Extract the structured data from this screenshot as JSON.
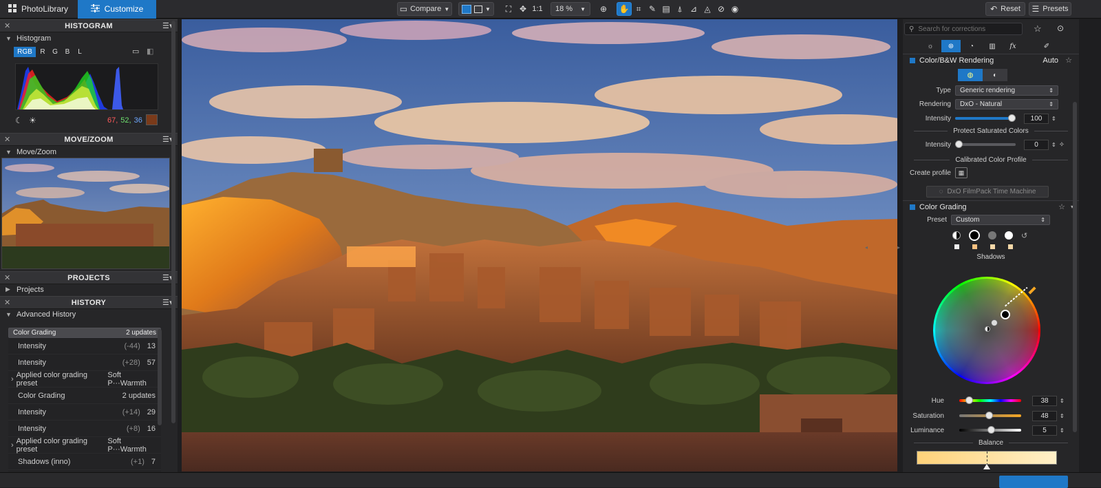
{
  "topbar": {
    "photolibrary_label": "PhotoLibrary",
    "customize_label": "Customize",
    "compare_label": "Compare",
    "ratio_label": "1:1",
    "zoom_value": "18 %",
    "reset_label": "Reset",
    "presets_label": "Presets"
  },
  "histogram": {
    "panel_title": "HISTOGRAM",
    "section_label": "Histogram",
    "channels": [
      "RGB",
      "R",
      "G",
      "B",
      "L"
    ],
    "active_channel": "RGB",
    "rgb_r": "67,",
    "rgb_g": "52,",
    "rgb_b": "36",
    "swatch_color": "#7a3a1a"
  },
  "movezoom": {
    "panel_title": "MOVE/ZOOM",
    "section_label": "Move/Zoom"
  },
  "projects": {
    "panel_title": "PROJECTS",
    "section_label": "Projects"
  },
  "history": {
    "panel_title": "HISTORY",
    "section_label": "Advanced History",
    "rows": [
      {
        "name": "Color Grading",
        "delta": "",
        "value": "2 updates",
        "expandable": false,
        "selected": true
      },
      {
        "name": "Intensity",
        "delta": "(-44)",
        "value": "13",
        "expandable": false,
        "selected": false
      },
      {
        "name": "Intensity",
        "delta": "(+28)",
        "value": "57",
        "expandable": false,
        "selected": false
      },
      {
        "name": "Applied color grading preset",
        "delta": "",
        "value": "Soft P···Warmth",
        "expandable": true,
        "selected": false
      },
      {
        "name": "Color Grading",
        "delta": "",
        "value": "2 updates",
        "expandable": false,
        "selected": false
      },
      {
        "name": "Intensity",
        "delta": "(+14)",
        "value": "29",
        "expandable": false,
        "selected": false
      },
      {
        "name": "Intensity",
        "delta": "(+8)",
        "value": "16",
        "expandable": false,
        "selected": false
      },
      {
        "name": "Applied color grading preset",
        "delta": "",
        "value": "Soft P···Warmth",
        "expandable": true,
        "selected": false
      },
      {
        "name": "Shadows (inno)",
        "delta": "(+1)",
        "value": "7",
        "expandable": false,
        "selected": false
      }
    ]
  },
  "right": {
    "search_placeholder": "Search for corrections",
    "color_bw": {
      "title": "Color/B&W Rendering",
      "auto_label": "Auto",
      "type_label": "Type",
      "type_value": "Generic rendering",
      "rendering_label": "Rendering",
      "rendering_value": "DxO - Natural",
      "intensity_label": "Intensity",
      "intensity_value": "100",
      "intensity_level": 1.0,
      "protect_title": "Protect Saturated Colors",
      "protect_intensity_label": "Intensity",
      "protect_intensity_value": "0",
      "protect_level": 0.0,
      "calibrated_title": "Calibrated Color Profile",
      "create_profile_label": "Create profile",
      "filmpack_label": "DxO FilmPack Time Machine"
    },
    "grading": {
      "title": "Color Grading",
      "preset_label": "Preset",
      "preset_value": "Custom",
      "tone_label": "Shadows",
      "hue_label": "Hue",
      "hue_value": "38",
      "hue_level": 0.11,
      "saturation_label": "Saturation",
      "saturation_value": "48",
      "saturation_level": 0.48,
      "luminance_label": "Luminance",
      "luminance_value": "5",
      "luminance_level": 0.52,
      "balance_label": "Balance",
      "accent_color": "#f5a623"
    }
  },
  "colors": {
    "accent": "#1f78c7",
    "panel": "#262628"
  }
}
